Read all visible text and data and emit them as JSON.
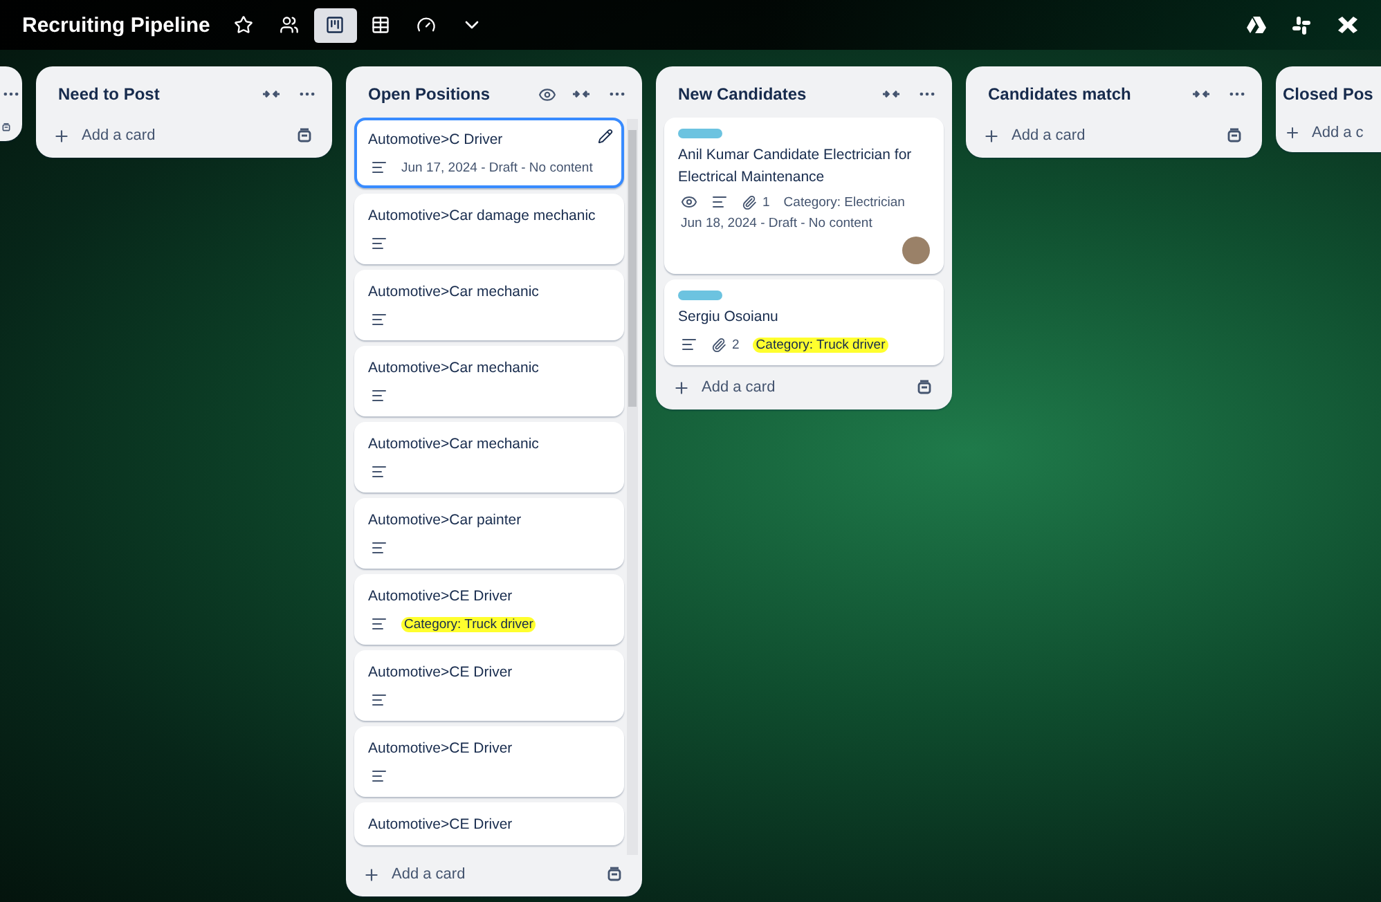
{
  "board": {
    "title": "Recruiting Pipeline",
    "starred": false,
    "views": [
      {
        "kind": "board",
        "selected": true
      },
      {
        "kind": "table",
        "selected": false
      },
      {
        "kind": "dashboard",
        "selected": false
      }
    ]
  },
  "lists": [
    {
      "kind": "partial"
    },
    {
      "kind": "list",
      "title": "Need to Post",
      "watched": false,
      "add_label": "Add a card"
    },
    {
      "kind": "list",
      "title": "Open Positions",
      "watched": true,
      "add_label": "Add a card",
      "cards": [
        {
          "title": "Automotive>C Driver",
          "selected": true,
          "badges": [
            {
              "kind": "description"
            },
            {
              "kind": "note",
              "text": "Jun 17, 2024 - Draft - No content"
            }
          ]
        },
        {
          "title": "Automotive>Car damage mechanic",
          "selected": false,
          "badges": [
            {
              "kind": "description"
            }
          ]
        },
        {
          "title": "Automotive>Car mechanic",
          "selected": false,
          "badges": [
            {
              "kind": "description"
            }
          ]
        },
        {
          "title": "Automotive>Car mechanic",
          "selected": false,
          "badges": [
            {
              "kind": "description"
            }
          ]
        },
        {
          "title": "Automotive>Car mechanic",
          "selected": false,
          "badges": [
            {
              "kind": "description"
            }
          ]
        },
        {
          "title": "Automotive>Car painter",
          "selected": false,
          "badges": [
            {
              "kind": "description"
            }
          ]
        },
        {
          "title": "Automotive>CE Driver",
          "selected": false,
          "badges": [
            {
              "kind": "description"
            },
            {
              "kind": "highlight",
              "text": "Category: Truck driver"
            }
          ]
        },
        {
          "title": "Automotive>CE Driver",
          "selected": false,
          "badges": [
            {
              "kind": "description"
            }
          ]
        },
        {
          "title": "Automotive>CE Driver",
          "selected": false,
          "badges": [
            {
              "kind": "description"
            }
          ]
        },
        {
          "title": "Automotive>CE Driver",
          "selected": false
        }
      ]
    },
    {
      "kind": "list",
      "title": "New Candidates",
      "watched": false,
      "add_label": "Add a card",
      "cards": [
        {
          "title": "Anil Kumar Candidate Electrician for Electrical Maintenance",
          "selected": false,
          "labels": [
            {
              "color": "#6cc3e0"
            }
          ],
          "badges": [
            {
              "kind": "watch"
            },
            {
              "kind": "description"
            },
            {
              "kind": "attachments",
              "text": "1"
            },
            {
              "kind": "note",
              "text": "Category: Electrician"
            },
            {
              "kind": "note",
              "text": "Jun 18, 2024 - Draft - No content"
            }
          ],
          "avatar": true
        },
        {
          "title": "Sergiu Osoianu",
          "selected": false,
          "labels": [
            {
              "color": "#6cc3e0"
            }
          ],
          "badges": [
            {
              "kind": "description"
            },
            {
              "kind": "attachments",
              "text": "2"
            },
            {
              "kind": "highlight",
              "text": "Category: Truck driver"
            }
          ]
        }
      ]
    },
    {
      "kind": "list",
      "title": "Candidates match",
      "watched": false,
      "add_label": "Add a card"
    },
    {
      "kind": "edge",
      "title": "Closed Pos",
      "add_label": "Add a c"
    }
  ]
}
